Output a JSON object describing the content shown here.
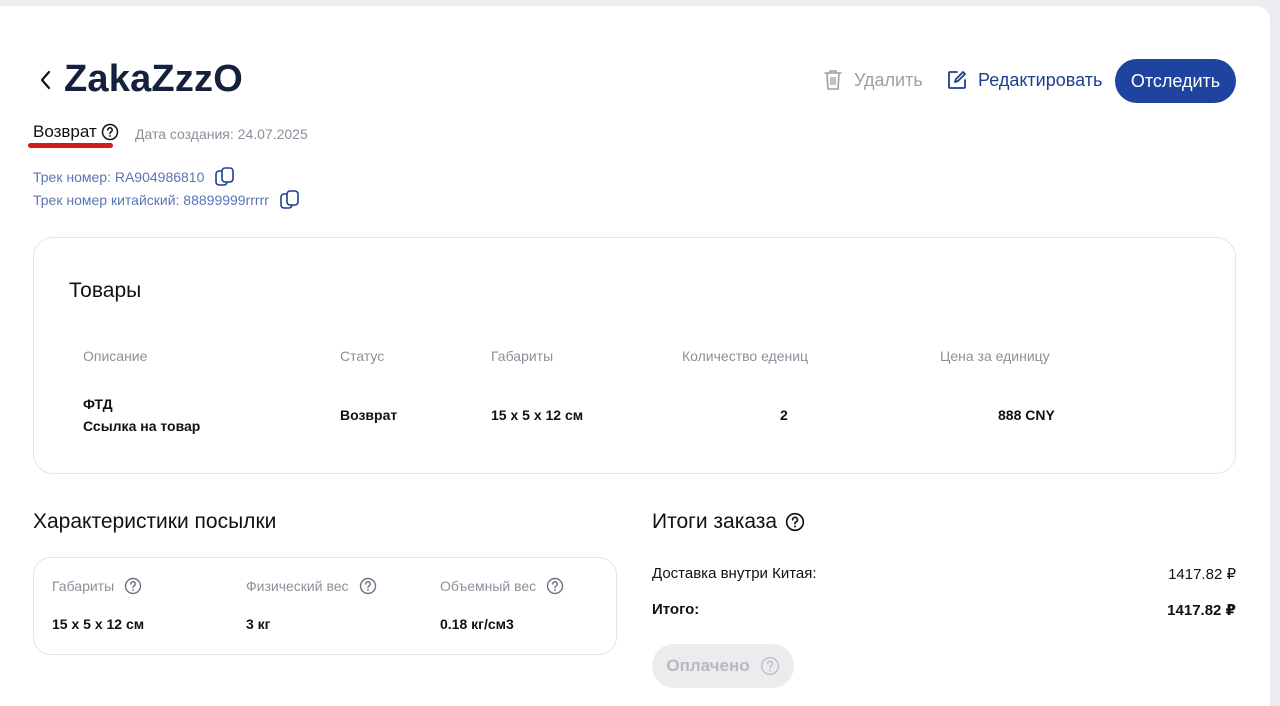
{
  "header": {
    "title": "ZakaZzzO",
    "delete_label": "Удалить",
    "edit_label": "Редактировать",
    "track_label": "Отследить"
  },
  "meta": {
    "type": "Возврат",
    "created": "Дата создания: 24.07.2025",
    "track_number": "Трек номер: RA904986810",
    "track_number_china": "Трек номер китайский: 88899999rrrrr"
  },
  "goods": {
    "title": "Товары",
    "columns": [
      "Описание",
      "Статус",
      "Габариты",
      "Количество едениц",
      "Цена за единицу"
    ],
    "rows": [
      {
        "name": "ФТД",
        "link": "Ссылка на товар",
        "status": "Возврат",
        "dimensions": "15 x 5 x 12 см",
        "quantity": "2",
        "price": "888 CNY"
      }
    ]
  },
  "parcel": {
    "title": "Характеристики посылки",
    "dimensions_label": "Габариты",
    "dimensions_value": "15 x 5 x 12 см",
    "weight_label": "Физический вес",
    "weight_value": "3 кг",
    "volume_label": "Объемный вес",
    "volume_value": "0.18 кг/см3"
  },
  "summary": {
    "title": "Итоги заказа",
    "delivery_label": "Доставка внутри Китая:",
    "delivery_value": "1417.82 ₽",
    "total_label": "Итого:",
    "total_value": "1417.82 ₽",
    "paid_label": "Оплачено"
  },
  "colors": {
    "primary": "#1f44a0",
    "title": "#14213d",
    "link": "#5b75b5",
    "muted": "#8b909a",
    "underline": "#d51c1c"
  }
}
